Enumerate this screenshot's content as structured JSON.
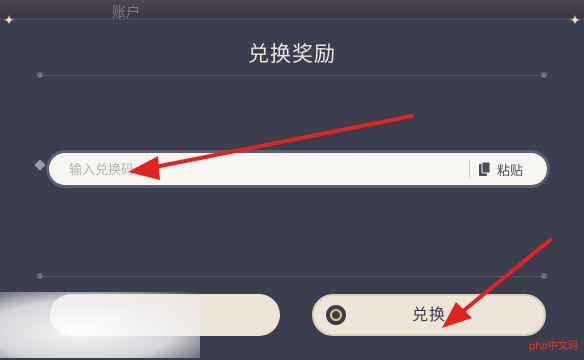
{
  "background": {
    "label": "账户"
  },
  "dialog": {
    "title": "兑换奖励",
    "input": {
      "placeholder": "输入兑换码",
      "value": ""
    },
    "paste_label": "粘贴",
    "confirm_label": "兑换",
    "cancel_label": ""
  },
  "watermark": "php中文网",
  "colors": {
    "panel": "#3b3e4f",
    "button": "#ece5d8",
    "arrow": "#e3221f",
    "accent": "#e3c26b"
  }
}
